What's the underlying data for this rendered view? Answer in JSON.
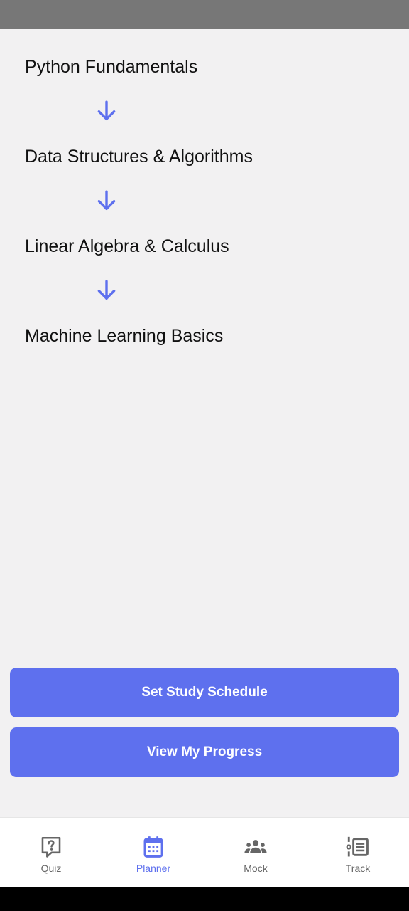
{
  "steps": [
    {
      "title": "Python Fundamentals"
    },
    {
      "title": "Data Structures & Algorithms"
    },
    {
      "title": "Linear Algebra & Calculus"
    },
    {
      "title": "Machine Learning Basics"
    }
  ],
  "buttons": {
    "set_schedule": "Set Study Schedule",
    "view_progress": "View My Progress"
  },
  "bottom_nav": {
    "active": "planner",
    "items": [
      {
        "label": "Quiz",
        "icon": "quiz-icon"
      },
      {
        "label": "Planner",
        "icon": "calendar-icon"
      },
      {
        "label": "Mock",
        "icon": "group-icon"
      },
      {
        "label": "Track",
        "icon": "track-list-icon"
      }
    ]
  },
  "colors": {
    "accent": "#5e70ee",
    "nav_inactive": "#666666",
    "background": "#f2f1f2",
    "status_bar": "#777777"
  }
}
